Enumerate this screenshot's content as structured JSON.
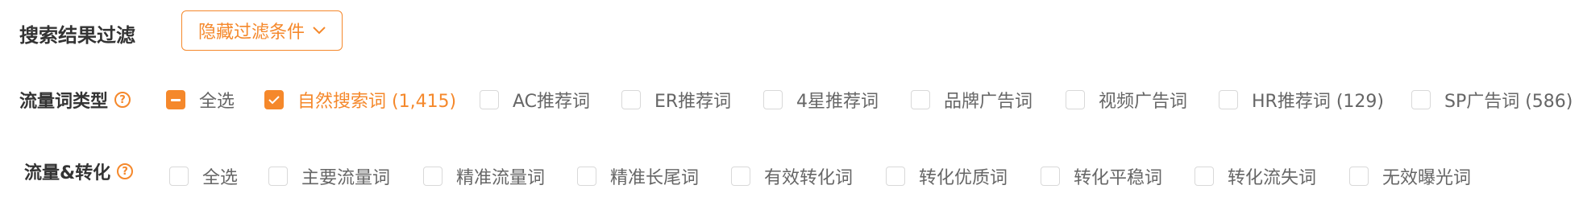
{
  "filter_title": "搜索结果过滤",
  "toggle_button": "隐藏过滤条件",
  "traffic_type": {
    "label": "流量词类型",
    "options": [
      {
        "text": "全选",
        "state": "indeterminate"
      },
      {
        "text": "自然搜索词 (1,415)",
        "state": "checked"
      },
      {
        "text": "AC推荐词",
        "state": "unchecked"
      },
      {
        "text": "ER推荐词",
        "state": "unchecked"
      },
      {
        "text": "4星推荐词",
        "state": "unchecked"
      },
      {
        "text": "品牌广告词",
        "state": "unchecked"
      },
      {
        "text": "视频广告词",
        "state": "unchecked"
      },
      {
        "text": "HR推荐词 (129)",
        "state": "unchecked"
      },
      {
        "text": "SP广告词 (586)",
        "state": "unchecked"
      }
    ]
  },
  "traffic_conversion": {
    "label": "流量&转化",
    "options": [
      {
        "text": "全选",
        "state": "unchecked"
      },
      {
        "text": "主要流量词",
        "state": "unchecked"
      },
      {
        "text": "精准流量词",
        "state": "unchecked"
      },
      {
        "text": "精准长尾词",
        "state": "unchecked"
      },
      {
        "text": "有效转化词",
        "state": "unchecked"
      },
      {
        "text": "转化优质词",
        "state": "unchecked"
      },
      {
        "text": "转化平稳词",
        "state": "unchecked"
      },
      {
        "text": "转化流失词",
        "state": "unchecked"
      },
      {
        "text": "无效曝光词",
        "state": "unchecked"
      }
    ]
  },
  "colors": {
    "accent": "#f5882b",
    "label": "#333333",
    "text": "#666666",
    "border": "#d9d9d9"
  }
}
